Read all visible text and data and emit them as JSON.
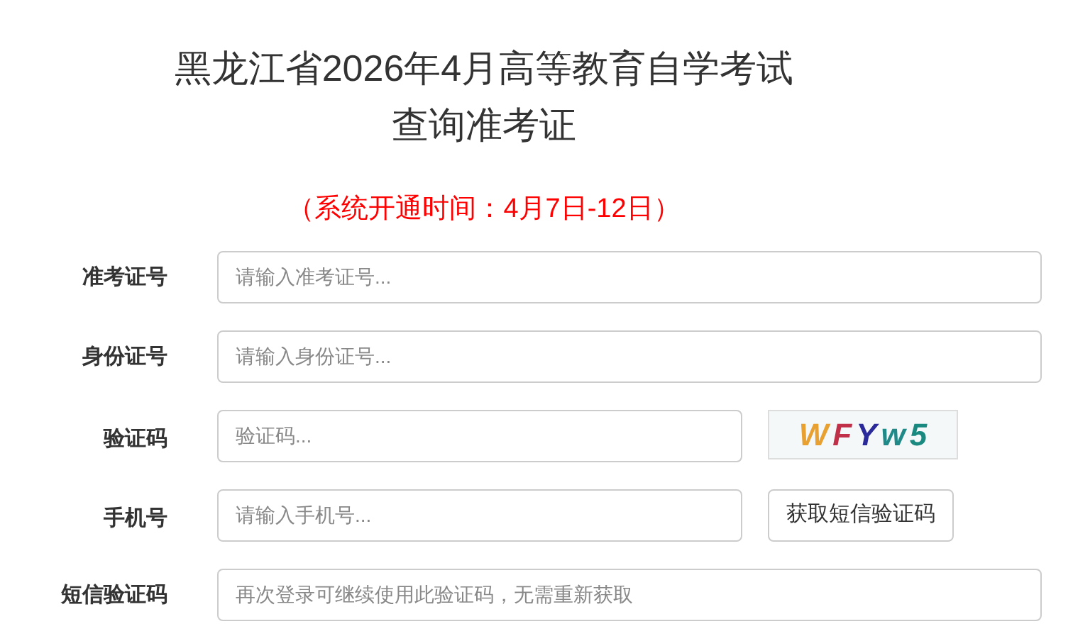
{
  "title_lines": [
    "黑龙江省2026年4月高等教育自学考试",
    "查询准考证"
  ],
  "notice": "（系统开通时间：4月7日-12日）",
  "fields": [
    {
      "kind": "wide",
      "label": "准考证号",
      "placeholder": "请输入准考证号..."
    },
    {
      "kind": "wide",
      "label": "身份证号",
      "placeholder": "请输入身份证号..."
    },
    {
      "kind": "captcha",
      "label": "验证码",
      "placeholder": "验证码...",
      "captcha": [
        {
          "char": "W",
          "color": "#e8a030"
        },
        {
          "char": "F",
          "color": "#c03048"
        },
        {
          "char": "Y",
          "color": "#2a2a9a"
        },
        {
          "char": "w",
          "color": "#208a88"
        },
        {
          "char": "5",
          "color": "#1a8a80"
        }
      ]
    },
    {
      "kind": "sms",
      "label": "手机号",
      "placeholder": "请输入手机号...",
      "button": "获取短信验证码"
    },
    {
      "kind": "wide",
      "label": "短信验证码",
      "placeholder": "再次登录可继续使用此验证码，无需重新获取"
    }
  ]
}
